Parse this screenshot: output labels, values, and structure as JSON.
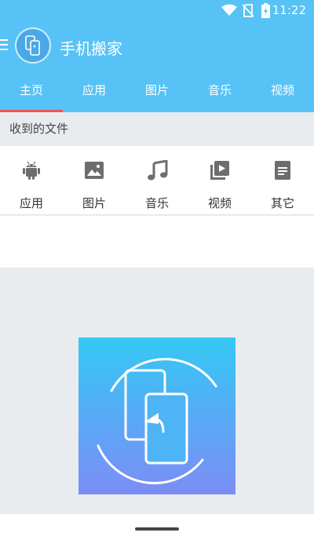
{
  "status_bar": {
    "time": "11:22",
    "icons": [
      "wifi-icon",
      "no-sim-icon",
      "battery-charging-icon"
    ]
  },
  "app_bar": {
    "title": "手机搬家",
    "menu_icon": "menu-icon",
    "logo_icon": "phone-transfer-logo"
  },
  "tabs": [
    {
      "label": "主页",
      "selected": true
    },
    {
      "label": "应用",
      "selected": false
    },
    {
      "label": "图片",
      "selected": false
    },
    {
      "label": "音乐",
      "selected": false
    },
    {
      "label": "视频",
      "selected": false
    }
  ],
  "received_section": {
    "title": "收到的文件"
  },
  "categories": [
    {
      "label": "应用",
      "icon": "android-icon"
    },
    {
      "label": "图片",
      "icon": "image-icon"
    },
    {
      "label": "音乐",
      "icon": "music-note-icon"
    },
    {
      "label": "视频",
      "icon": "video-library-icon"
    },
    {
      "label": "其它",
      "icon": "document-icon"
    }
  ],
  "colors": {
    "header": "#57c2f5",
    "tab_indicator": "#ef5350",
    "background": "#e9ecef",
    "icon_gray": "#6d6d6d"
  }
}
